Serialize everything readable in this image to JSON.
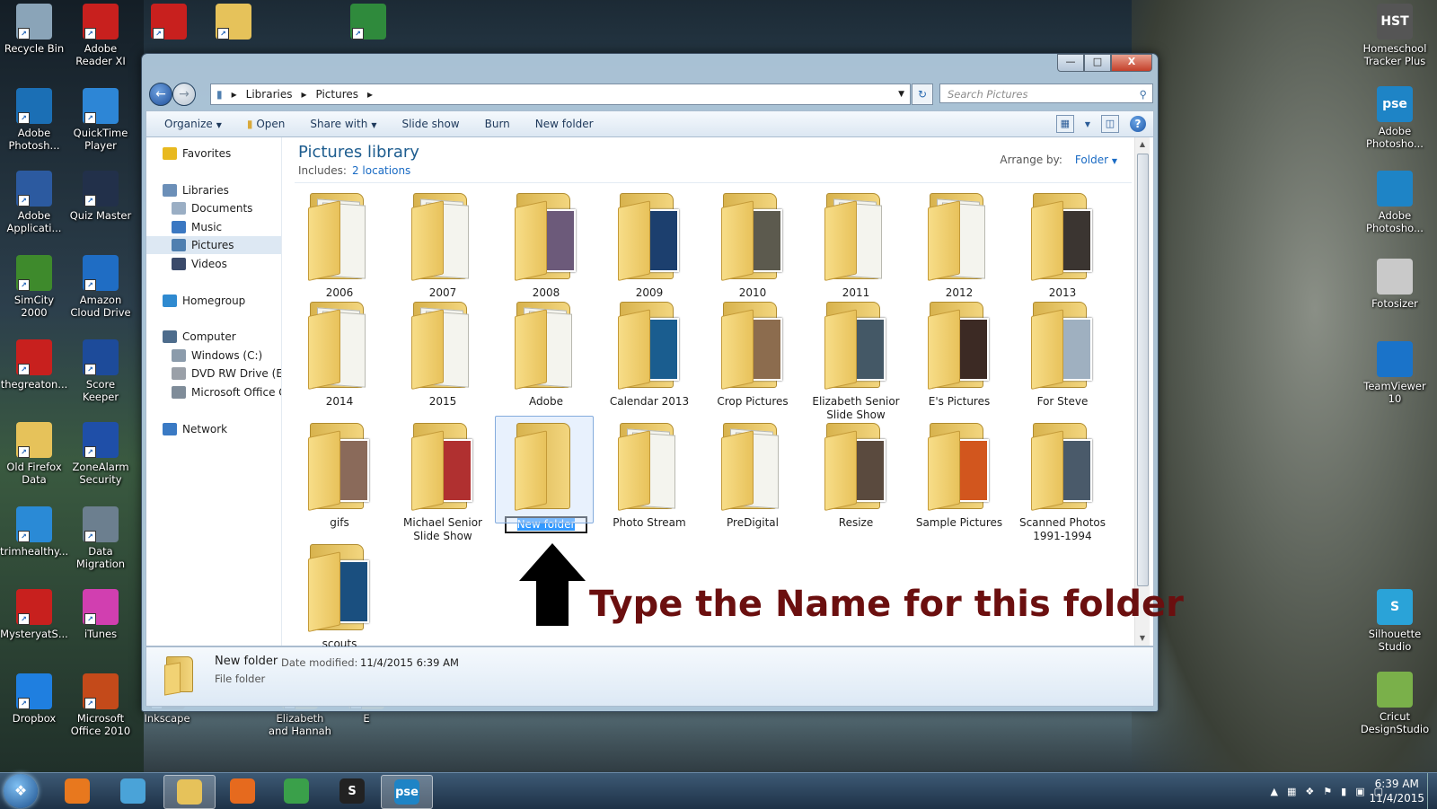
{
  "desktop": {
    "left_icons": [
      {
        "label": "Recycle Bin",
        "icon": "recycle-bin-icon",
        "color": "#8aa4b8"
      },
      {
        "label": "Adobe Reader XI",
        "icon": "pdf-icon",
        "color": "#c8201e"
      },
      {
        "label": "",
        "icon": "pdf-icon",
        "color": "#c8201e"
      },
      {
        "label": "",
        "icon": "folder-icon",
        "color": "#e6c25a"
      },
      {
        "label": "",
        "icon": "ynab-icon",
        "color": "#2f8a3c"
      },
      {
        "label": "Adobe Photosh...",
        "icon": "photoshop-icon",
        "color": "#1b6fb5"
      },
      {
        "label": "QuickTime Player",
        "icon": "quicktime-icon",
        "color": "#2d86d6"
      },
      {
        "label": "Adobe Applicati...",
        "icon": "app-manager-icon",
        "color": "#2c5aa0"
      },
      {
        "label": "Quiz Master",
        "icon": "quiz-icon",
        "color": "#22304a"
      },
      {
        "label": "SimCity 2000",
        "icon": "tree-icon",
        "color": "#3e8a2c"
      },
      {
        "label": "Amazon Cloud Drive",
        "icon": "amazon-icon",
        "color": "#1f6dc4"
      },
      {
        "label": "thegreaton...",
        "icon": "pdf-icon",
        "color": "#c8201e"
      },
      {
        "label": "Score Keeper",
        "icon": "sk-icon",
        "color": "#1d4b9a"
      },
      {
        "label": "Old Firefox Data",
        "icon": "folder-icon",
        "color": "#e6c25a"
      },
      {
        "label": "ZoneAlarm Security",
        "icon": "zonealarm-icon",
        "color": "#1f4fa8"
      },
      {
        "label": "trimhealthy...",
        "icon": "book-icon",
        "color": "#2a8ad6"
      },
      {
        "label": "Data Migration",
        "icon": "migration-icon",
        "color": "#6c7f8f"
      },
      {
        "label": "MysteryatS...",
        "icon": "pdf-icon",
        "color": "#c8201e"
      },
      {
        "label": "iTunes",
        "icon": "itunes-icon",
        "color": "#d13fb0"
      },
      {
        "label": "Dropbox",
        "icon": "dropbox-icon",
        "color": "#1f7fe0"
      },
      {
        "label": "Microsoft Office 2010",
        "icon": "office-icon",
        "color": "#c44a1a"
      },
      {
        "label": "Inkscape",
        "icon": "inkscape-icon",
        "color": "#333333"
      },
      {
        "label": "Elizabeth and Hannah",
        "icon": "folder-icon",
        "color": "#e6c25a"
      },
      {
        "label": "E",
        "icon": "folder-icon",
        "color": "#e6c25a"
      }
    ],
    "right_icons": [
      {
        "label": "Homeschool Tracker Plus",
        "icon": "hst-icon",
        "color": "#555555",
        "short": "HST"
      },
      {
        "label": "Adobe Photosho...",
        "icon": "pse-icon",
        "color": "#1e84c6",
        "short": "pse"
      },
      {
        "label": "Adobe Photosho...",
        "icon": "photoshop-icon",
        "color": "#1e84c6",
        "short": ""
      },
      {
        "label": "Fotosizer",
        "icon": "camera-icon",
        "color": "#c9c9c9",
        "short": ""
      },
      {
        "label": "TeamViewer 10",
        "icon": "teamviewer-icon",
        "color": "#1a73c9",
        "short": ""
      },
      {
        "label": "Silhouette Studio",
        "icon": "silhouette-icon",
        "color": "#2aa3d8",
        "short": "S"
      },
      {
        "label": "Cricut DesignStudio",
        "icon": "cricut-icon",
        "color": "#7ab04a",
        "short": ""
      }
    ]
  },
  "window": {
    "controls": {
      "minimize": "—",
      "maximize": "□",
      "close": "X"
    },
    "breadcrumb": [
      "Libraries",
      "Pictures"
    ],
    "search_placeholder": "Search Pictures",
    "toolbar": {
      "organize": "Organize",
      "open": "Open",
      "share_with": "Share with",
      "slide_show": "Slide show",
      "burn": "Burn",
      "new_folder": "New folder"
    },
    "sidebar": [
      {
        "label": "Favorites",
        "icon": "star-icon",
        "color": "#e8b91f",
        "indent": 0,
        "gap": 0
      },
      {
        "label": "Libraries",
        "icon": "library-icon",
        "color": "#6b8fb8",
        "indent": 0,
        "gap": 1
      },
      {
        "label": "Documents",
        "icon": "documents-icon",
        "color": "#9aaec4",
        "indent": 1,
        "gap": 0
      },
      {
        "label": "Music",
        "icon": "music-icon",
        "color": "#3b78c2",
        "indent": 1,
        "gap": 0
      },
      {
        "label": "Pictures",
        "icon": "pictures-icon",
        "color": "#4f7fb0",
        "indent": 1,
        "gap": 0,
        "selected": true
      },
      {
        "label": "Videos",
        "icon": "videos-icon",
        "color": "#3a4a6a",
        "indent": 1,
        "gap": 0
      },
      {
        "label": "Homegroup",
        "icon": "homegroup-icon",
        "color": "#2f8ad0",
        "indent": 0,
        "gap": 1
      },
      {
        "label": "Computer",
        "icon": "computer-icon",
        "color": "#4d6c8c",
        "indent": 0,
        "gap": 1
      },
      {
        "label": "Windows (C:)",
        "icon": "drive-icon",
        "color": "#8b9bab",
        "indent": 1,
        "gap": 0
      },
      {
        "label": "DVD RW Drive (E:) I",
        "icon": "dvd-icon",
        "color": "#9aa0a8",
        "indent": 1,
        "gap": 0
      },
      {
        "label": "Microsoft Office Cl",
        "icon": "drive-icon",
        "color": "#7f8c99",
        "indent": 1,
        "gap": 0
      },
      {
        "label": "Network",
        "icon": "network-icon",
        "color": "#3a7ac4",
        "indent": 0,
        "gap": 1
      }
    ],
    "library": {
      "title": "Pictures library",
      "includes_label": "Includes:",
      "locations": "2 locations",
      "arrange_by_label": "Arrange by:",
      "arrange_by_value": "Folder"
    },
    "folders": [
      {
        "name": "2006",
        "style": "plain"
      },
      {
        "name": "2007",
        "style": "plain"
      },
      {
        "name": "2008",
        "style": "photo",
        "color": "#6c5a7a"
      },
      {
        "name": "2009",
        "style": "photo",
        "color": "#1c3f6e"
      },
      {
        "name": "2010",
        "style": "photo",
        "color": "#5c5a4e"
      },
      {
        "name": "2011",
        "style": "plain"
      },
      {
        "name": "2012",
        "style": "plain"
      },
      {
        "name": "2013",
        "style": "photo",
        "color": "#3b3531"
      },
      {
        "name": "2014",
        "style": "plain"
      },
      {
        "name": "2015",
        "style": "plain"
      },
      {
        "name": "Adobe",
        "style": "plain"
      },
      {
        "name": "Calendar 2013",
        "style": "photo",
        "color": "#1a5d8f"
      },
      {
        "name": "Crop Pictures",
        "style": "photo",
        "color": "#8c6c4e"
      },
      {
        "name": "Elizabeth Senior Slide Show",
        "style": "photo",
        "color": "#445866"
      },
      {
        "name": "E's Pictures",
        "style": "photo",
        "color": "#3c2a24"
      },
      {
        "name": "For Steve",
        "style": "photo",
        "color": "#9fb0c0"
      },
      {
        "name": "gifs",
        "style": "photo",
        "color": "#8a6a5a"
      },
      {
        "name": "Michael Senior Slide Show",
        "style": "photo",
        "color": "#b03030"
      },
      {
        "name": "New folder",
        "style": "empty",
        "selected": true
      },
      {
        "name": "Photo Stream",
        "style": "plain"
      },
      {
        "name": "PreDigital",
        "style": "plain"
      },
      {
        "name": "Resize",
        "style": "photo",
        "color": "#5a4a3e"
      },
      {
        "name": "Sample Pictures",
        "style": "photo",
        "color": "#d2561e"
      },
      {
        "name": "Scanned Photos 1991-1994",
        "style": "photo",
        "color": "#4a5a6a"
      },
      {
        "name": "scouts",
        "style": "photo",
        "color": "#1a4f7f"
      }
    ],
    "details": {
      "name": "New folder",
      "date_label": "Date modified:",
      "date_value": "11/4/2015 6:39 AM",
      "type": "File folder"
    }
  },
  "annotation": {
    "text": "Type the Name for this folder",
    "color": "#6b0f0f"
  },
  "taskbar": {
    "apps": [
      {
        "name": "media-player-icon",
        "label": "",
        "color": "#e8781e"
      },
      {
        "name": "people-icon",
        "label": "",
        "color": "#4aa3d8"
      },
      {
        "name": "explorer-icon",
        "label": "",
        "color": "#e6c25a",
        "active": true
      },
      {
        "name": "firefox-icon",
        "label": "",
        "color": "#e66a1e"
      },
      {
        "name": "chrome-icon",
        "label": "",
        "color": "#3aa04a"
      },
      {
        "name": "silhouette-icon",
        "label": "S",
        "color": "#222222"
      },
      {
        "name": "pse-icon",
        "label": "pse",
        "color": "#1e84c6",
        "active": true
      }
    ],
    "clock_time": "6:39 AM",
    "clock_date": "11/4/2015"
  }
}
